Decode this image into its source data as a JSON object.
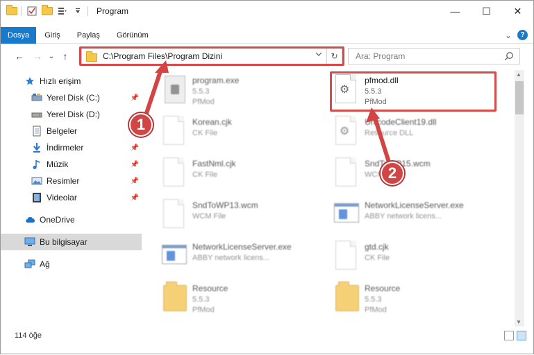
{
  "window": {
    "title": "Program",
    "minimize": "—",
    "maximize": "☐",
    "close": "✕"
  },
  "ribbon": {
    "tabs": [
      "Dosya",
      "Giriş",
      "Paylaş",
      "Görünüm"
    ],
    "chevron": "⌄",
    "help": "?"
  },
  "nav": {
    "back": "←",
    "forward": "→",
    "recent": "⌄",
    "up": "↑",
    "address": "C:\\Program Files\\Program Dizini",
    "refresh": "↻",
    "search_placeholder": "Ara: Program"
  },
  "sidebar": {
    "items": [
      {
        "label": "Hızlı erişim",
        "icon": "star-icon"
      },
      {
        "label": "Yerel Disk (C:)",
        "icon": "drive-icon"
      },
      {
        "label": "Yerel Disk (D:)",
        "icon": "drive-icon"
      },
      {
        "label": "Belgeler",
        "icon": "documents-icon"
      },
      {
        "label": "İndirmeler",
        "icon": "download-icon"
      },
      {
        "label": "Müzik",
        "icon": "music-icon"
      },
      {
        "label": "Resimler",
        "icon": "pictures-icon"
      },
      {
        "label": "Videolar",
        "icon": "video-icon"
      },
      {
        "label": "OneDrive",
        "icon": "cloud-icon"
      },
      {
        "label": "Bu bilgisayar",
        "icon": "computer-icon"
      },
      {
        "label": "Ağ",
        "icon": "network-icon"
      }
    ]
  },
  "files": [
    {
      "name": "program.exe",
      "line2": "5.5.3",
      "line3": "PfMod",
      "icon": "exe"
    },
    {
      "name": "pfmod.dll",
      "line2": "5.5.3",
      "line3": "PfMod",
      "icon": "dll"
    },
    {
      "name": "Korean.cjk",
      "line2": "CK File",
      "line3": "",
      "icon": "doc"
    },
    {
      "name": "UnicodeClient19.dll",
      "line2": "Resource DLL",
      "line3": "",
      "icon": "dll"
    },
    {
      "name": "FastNml.cjk",
      "line2": "CK File",
      "line3": "",
      "icon": "doc"
    },
    {
      "name": "SndToWP15.wcm",
      "line2": "WCM File",
      "line3": "",
      "icon": "doc"
    },
    {
      "name": "SndToWP13.wcm",
      "line2": "WCM File",
      "line3": "",
      "icon": "doc"
    },
    {
      "name": "NetworkLicenseServer.exe",
      "line2": "ABBY network licens...",
      "line3": "",
      "icon": "app"
    },
    {
      "name": "NetworkLicenseServer.exe",
      "line2": "ABBY network licens...",
      "line3": "",
      "icon": "app"
    },
    {
      "name": "gtd.cjk",
      "line2": "CK File",
      "line3": "",
      "icon": "doc"
    },
    {
      "name": "Resource",
      "line2": "5.5.3",
      "line3": "PfMod",
      "icon": "folder"
    },
    {
      "name": "Resource",
      "line2": "5.5.3",
      "line3": "PfMod",
      "icon": "folder"
    }
  ],
  "status": {
    "count": "114 öğe"
  },
  "callouts": [
    "1",
    "2"
  ],
  "colors": {
    "accent": "#1979ca",
    "highlight": "#d64a4a"
  }
}
